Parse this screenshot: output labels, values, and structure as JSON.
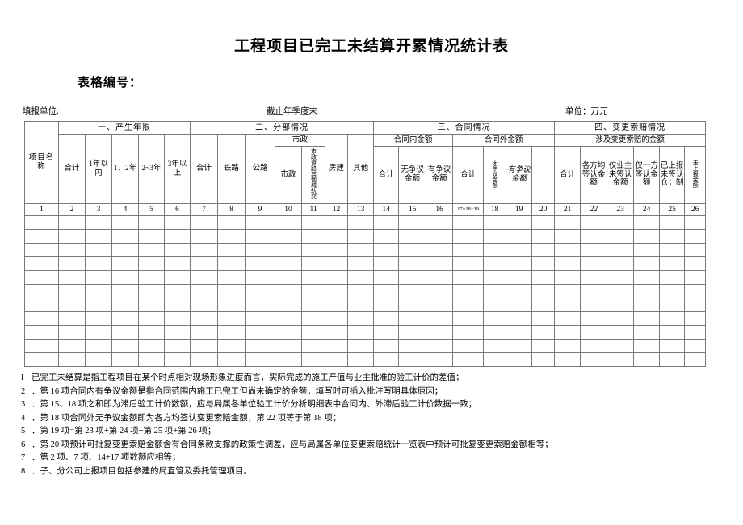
{
  "document": {
    "title": "工程项目已完工未结算开累情况统计表",
    "form_number_label": "表格编号：",
    "meta": {
      "reporting_unit": "填报单位:",
      "period": "截止年季度末",
      "unit": "单位：万元"
    }
  },
  "table": {
    "row_header_label": "项目名称",
    "groups": {
      "g1": "一、产生年限",
      "g2": "二、分部情况",
      "g3": "三、合同情况",
      "g4": "四、变更索赔情况"
    },
    "subgroups": {
      "municipal": "市政",
      "in_contract": "合同内金额",
      "out_contract": "合同外金额",
      "change_claim_amount": "涉及变更索赔的金额"
    },
    "leaf_headers": {
      "y_total": "合计",
      "y_within1": "1年以内",
      "y_1_2": "1、2年",
      "y_2_3": "2~3年",
      "y_over3": "3年以上",
      "d_total": "合计",
      "d_railway": "铁路",
      "d_highway": "公路",
      "d_municipal": "市政",
      "d_municipal_other": "市政道路其他城轨交",
      "d_housing": "房建",
      "d_other": "其他",
      "in_total": "合计",
      "in_undisputed": "无争议金额",
      "in_disputed": "有争议金额",
      "out_total": "合计",
      "out_undisputed": "无争议金额",
      "out_disputed": "有争议金额",
      "cc_total": "合计",
      "cc_all_signed": "各方均签认金额",
      "cc_owner_unsigned": "仅业主未签认金额",
      "cc_one_signed": "仅一方签认金额",
      "cc_reported_unsigned": "已上报未签认仓；制",
      "cc_not_reported": "未上报金额"
    },
    "column_numbers": [
      "1",
      "2",
      "3",
      "4",
      "5",
      "6",
      "7",
      "8",
      "9",
      "10",
      "11",
      "12",
      "13",
      "14",
      "15",
      "16",
      "17=18+19",
      "18",
      "19",
      "20",
      "21",
      "22",
      "23",
      "24",
      "25",
      "26"
    ],
    "empty_body_rows": 11
  },
  "notes": [
    {
      "idx": "l",
      "text": "已完工未结算是指工程项目在某个时点相对现场形象进度而言，实际完成的施工产值与业主批准的验工计价的差值；"
    },
    {
      "idx": "2",
      "text": "．第 16 项合同内有争议金额是指合同范围内施工已完工但尚未确定的金额，填写时可插入批注写明具体原因；"
    },
    {
      "idx": "3",
      "text": "．第 15、18 项之和即为滞后验工计价数额，应与局属各单位验工计价分析明细表中合同内、外滞后验工计价数据一致；"
    },
    {
      "idx": "4",
      "text": "．第 18 项合同外无争议金额即为各方均签认变更索赔金额，第 22 项等于第 18 项；"
    },
    {
      "idx": "5",
      "text": "．第 19 项=第 23 项+第 24 项+第 25 项+第 26 项；"
    },
    {
      "idx": "6",
      "text": "．第 20 项预计可批复变更索赔金额含有合同条款支撑的政策性调差，应与局属各单位变更索赔统计一览表中预计可批复变更索赔金额相等；"
    },
    {
      "idx": "7",
      "text": "．第 2 项、7 项、14+17 项数额应相等；"
    },
    {
      "idx": "8",
      "text": "．子、分公司上报项目包括参建的局直管及委托管理项目。"
    }
  ]
}
